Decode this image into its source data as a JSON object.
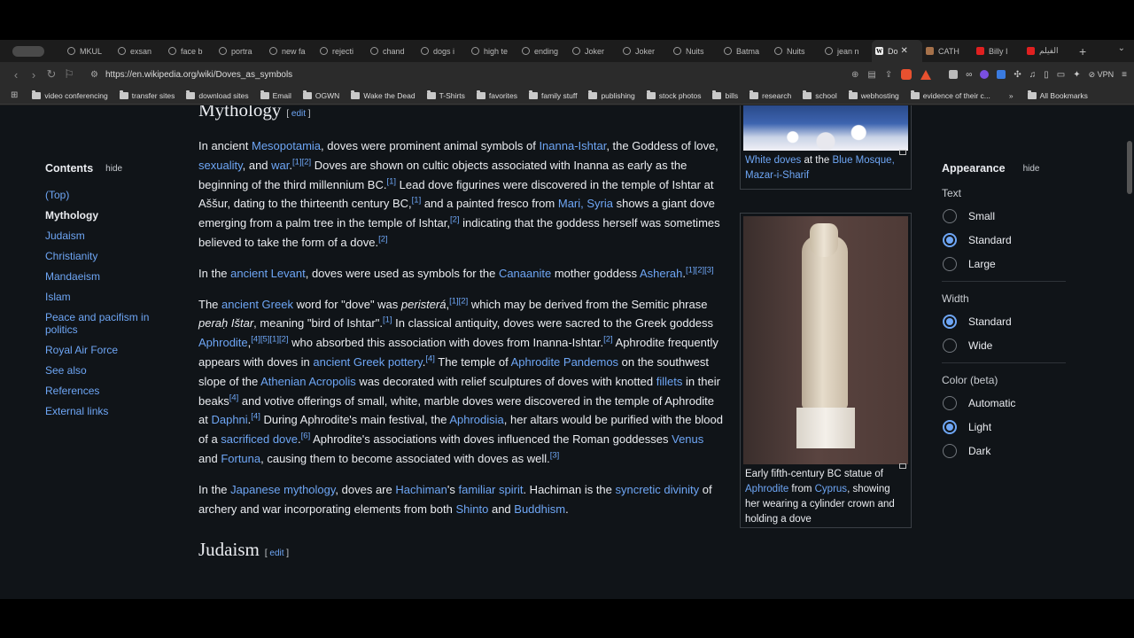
{
  "tabs": [
    {
      "label": "MKUL",
      "icon": "globe-icon"
    },
    {
      "label": "exsan",
      "icon": "globe-icon"
    },
    {
      "label": "face b",
      "icon": "globe-icon"
    },
    {
      "label": "portra",
      "icon": "globe-icon"
    },
    {
      "label": "new fa",
      "icon": "globe-icon"
    },
    {
      "label": "rejecti",
      "icon": "globe-icon"
    },
    {
      "label": "chand",
      "icon": "globe-icon"
    },
    {
      "label": "dogs i",
      "icon": "globe-icon"
    },
    {
      "label": "high te",
      "icon": "globe-icon"
    },
    {
      "label": "ending",
      "icon": "globe-icon"
    },
    {
      "label": "Joker",
      "icon": "globe-icon"
    },
    {
      "label": "Joker",
      "icon": "globe-icon"
    },
    {
      "label": "Nuits",
      "icon": "globe-icon"
    },
    {
      "label": "Batma",
      "icon": "globe-icon"
    },
    {
      "label": "Nuits",
      "icon": "globe-icon"
    },
    {
      "label": "jean n",
      "icon": "globe-icon"
    },
    {
      "label": "Do",
      "icon": "wikipedia-icon",
      "active": true
    },
    {
      "label": "CATH",
      "icon": "image-icon"
    },
    {
      "label": "Billy I",
      "icon": "youtube-icon"
    },
    {
      "label": "الفيلم",
      "icon": "youtube-icon"
    }
  ],
  "address_bar": {
    "url": "https://en.wikipedia.org/wiki/Doves_as_symbols",
    "vpn_label": "VPN"
  },
  "bookmarks": [
    "video conferencing",
    "transfer sites",
    "download sites",
    "Email",
    "OGWN",
    "Wake the Dead",
    "T-Shirts",
    "favorites",
    "family stuff",
    "publishing",
    "stock photos",
    "bills",
    "research",
    "school",
    "webhosting",
    "evidence of their c..."
  ],
  "bookmarks_all": "All Bookmarks",
  "toc": {
    "title": "Contents",
    "hide": "hide",
    "items": [
      "(Top)",
      "Mythology",
      "Judaism",
      "Christianity",
      "Mandaeism",
      "Islam",
      "Peace and pacifism in politics",
      "Royal Air Force",
      "See also",
      "References",
      "External links"
    ]
  },
  "article": {
    "section1_title": "Mythology",
    "edit": "edit",
    "section2_title": "Judaism"
  },
  "figures": {
    "fig1_caption_link1": "White doves",
    "fig1_caption_text1": " at the ",
    "fig1_caption_link2": "Blue Mosque, Mazar-i-Sharif",
    "fig2_caption_text1": "Early fifth-century BC statue of ",
    "fig2_caption_link1": "Aphrodite",
    "fig2_caption_text2": " from ",
    "fig2_caption_link2": "Cyprus",
    "fig2_caption_text3": ", showing her wearing a cylinder crown and holding a dove"
  },
  "appearance": {
    "title": "Appearance",
    "hide": "hide",
    "text_label": "Text",
    "text_options": [
      "Small",
      "Standard",
      "Large"
    ],
    "text_selected": "Standard",
    "width_label": "Width",
    "width_options": [
      "Standard",
      "Wide"
    ],
    "width_selected": "Standard",
    "color_label": "Color (beta)",
    "color_options": [
      "Automatic",
      "Light",
      "Dark"
    ],
    "color_selected": "Light"
  },
  "colors": {
    "link": "#6ea6f5",
    "page_bg": "#101418",
    "text": "#eaecf0"
  }
}
